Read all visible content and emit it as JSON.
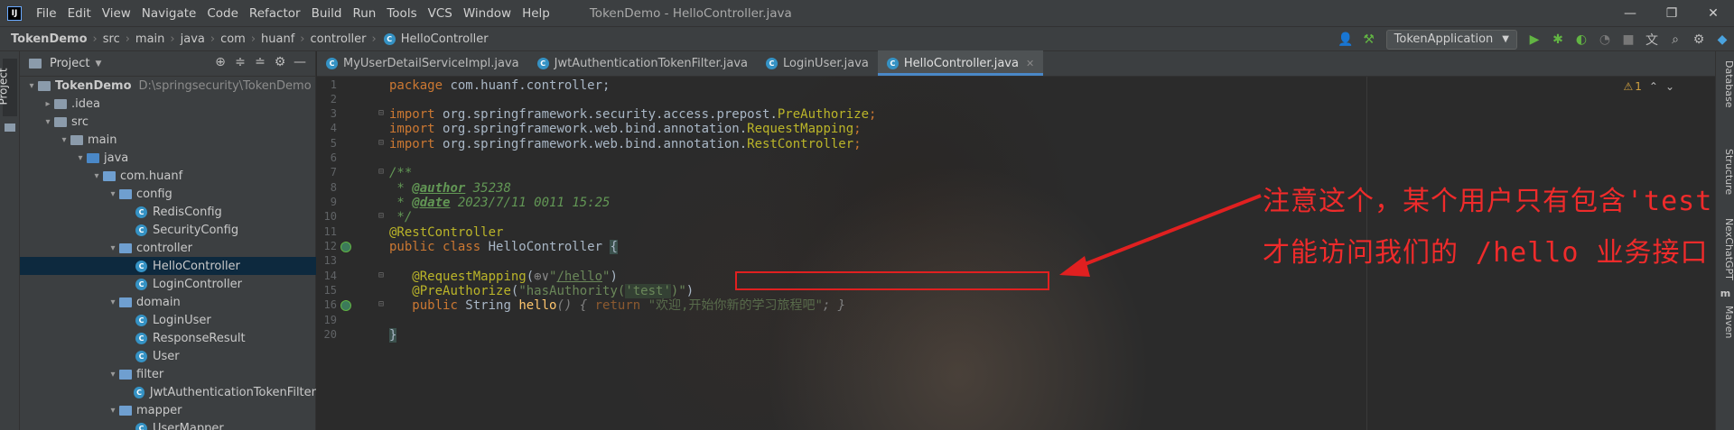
{
  "titlebar": {
    "logo": "IJ",
    "menu": [
      "File",
      "Edit",
      "View",
      "Navigate",
      "Code",
      "Refactor",
      "Build",
      "Run",
      "Tools",
      "VCS",
      "Window",
      "Help"
    ],
    "window_title": "TokenDemo - HelloController.java"
  },
  "breadcrumbs": [
    "TokenDemo",
    "src",
    "main",
    "java",
    "com",
    "huanf",
    "controller",
    "HelloController"
  ],
  "run_config": "TokenApplication",
  "left_strip": {
    "project_tab": "Project"
  },
  "project_panel": {
    "title": "Project",
    "tree": [
      {
        "label": "TokenDemo",
        "path": "D:\\springsecurity\\TokenDemo",
        "depth": 0,
        "kind": "project",
        "open": true
      },
      {
        "label": ".idea",
        "depth": 1,
        "kind": "folder",
        "open": false
      },
      {
        "label": "src",
        "depth": 1,
        "kind": "folder",
        "open": true
      },
      {
        "label": "main",
        "depth": 2,
        "kind": "folder",
        "open": true
      },
      {
        "label": "java",
        "depth": 3,
        "kind": "src",
        "open": true
      },
      {
        "label": "com.huanf",
        "depth": 4,
        "kind": "package",
        "open": true
      },
      {
        "label": "config",
        "depth": 5,
        "kind": "package",
        "open": true
      },
      {
        "label": "RedisConfig",
        "depth": 6,
        "kind": "class"
      },
      {
        "label": "SecurityConfig",
        "depth": 6,
        "kind": "class"
      },
      {
        "label": "controller",
        "depth": 5,
        "kind": "package",
        "open": true
      },
      {
        "label": "HelloController",
        "depth": 6,
        "kind": "class",
        "selected": true
      },
      {
        "label": "LoginController",
        "depth": 6,
        "kind": "class"
      },
      {
        "label": "domain",
        "depth": 5,
        "kind": "package",
        "open": true
      },
      {
        "label": "LoginUser",
        "depth": 6,
        "kind": "class"
      },
      {
        "label": "ResponseResult",
        "depth": 6,
        "kind": "class"
      },
      {
        "label": "User",
        "depth": 6,
        "kind": "class"
      },
      {
        "label": "filter",
        "depth": 5,
        "kind": "package",
        "open": true
      },
      {
        "label": "JwtAuthenticationTokenFilter",
        "depth": 6,
        "kind": "class"
      },
      {
        "label": "mapper",
        "depth": 5,
        "kind": "package",
        "open": true
      },
      {
        "label": "UserMapper",
        "depth": 6,
        "kind": "class"
      }
    ]
  },
  "tabs": [
    {
      "label": "MyUserDetailServiceImpl.java",
      "active": false
    },
    {
      "label": "JwtAuthenticationTokenFilter.java",
      "active": false
    },
    {
      "label": "LoginUser.java",
      "active": false
    },
    {
      "label": "HelloController.java",
      "active": true
    }
  ],
  "editor": {
    "warnings": "1",
    "line_numbers": [
      "1",
      "2",
      "3",
      "4",
      "5",
      "6",
      "7",
      "8",
      "9",
      "10",
      "11",
      "12",
      "13",
      "14",
      "15",
      "16",
      "19",
      "20"
    ],
    "code": {
      "l1": [
        "package",
        " com.huanf.controller;"
      ],
      "l3": [
        "import",
        " org.springframework.security.access.prepost.",
        "PreAuthorize",
        ";"
      ],
      "l4": [
        "import",
        " org.springframework.web.bind.annotation.",
        "RequestMapping",
        ";"
      ],
      "l5": [
        "import",
        " org.springframework.web.bind.annotation.",
        "RestController",
        ";"
      ],
      "l7": "/**",
      "l8": [
        " * ",
        "@author",
        " 35238"
      ],
      "l9": [
        " * ",
        "@date",
        " 2023/7/11 0011 15:25"
      ],
      "l10": " */",
      "l11": "@RestController",
      "l12": [
        "public class",
        " HelloController ",
        "{"
      ],
      "l14": [
        "@RequestMapping",
        "(",
        "⊕∨",
        "\"",
        "/hello",
        "\"",
        ")"
      ],
      "l15": [
        "@PreAuthorize",
        "(",
        "\"hasAuthority(",
        "'test'",
        ")\"",
        ")"
      ],
      "l16": [
        "public",
        " String ",
        "hello",
        "() { ",
        "return",
        " \"欢迎,开始你新的学习旅程吧\"",
        "; }"
      ],
      "l20": "}"
    },
    "annotation_text": [
      "注意这个，某个用户只有包含'test'权限",
      "才能访问我们的 /hello 业务接口"
    ],
    "annotation_color": "#ef2b2b"
  },
  "right_strip": [
    "Database",
    "Structure",
    "NexChatGPT",
    "m",
    "Maven"
  ]
}
